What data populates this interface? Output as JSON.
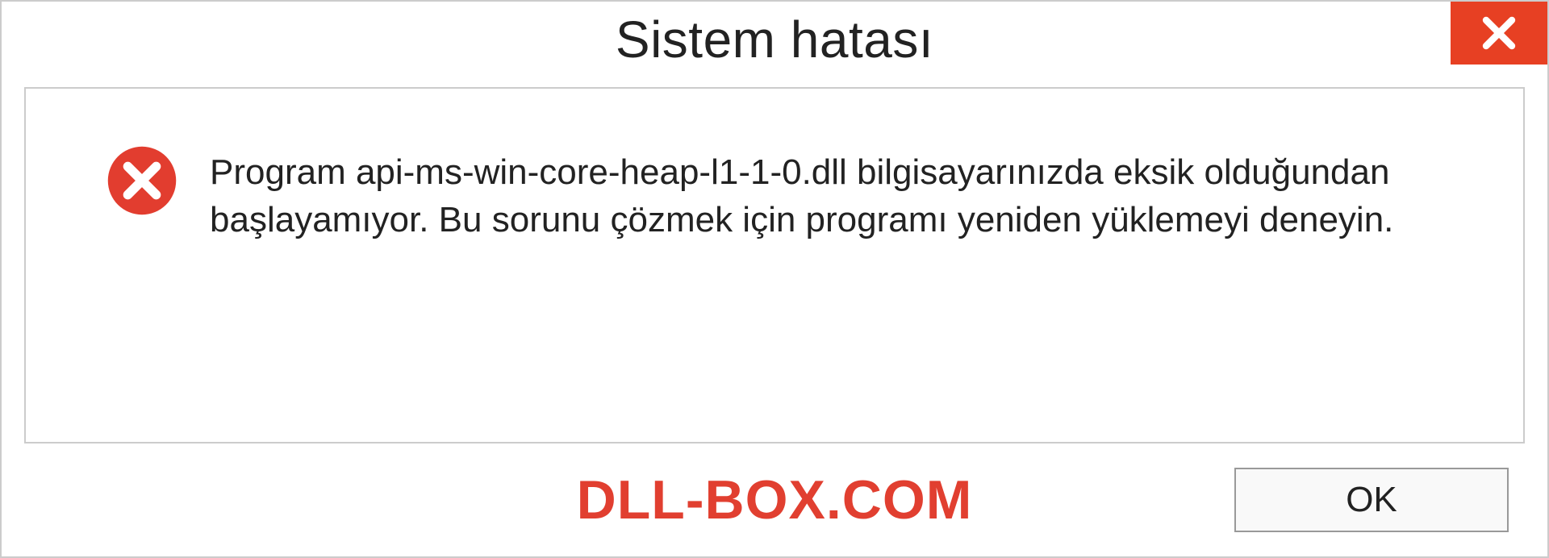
{
  "dialog": {
    "title": "Sistem hatası",
    "message": "Program api-ms-win-core-heap-l1-1-0.dll bilgisayarınızda eksik olduğundan başlayamıyor. Bu sorunu çözmek için programı yeniden yüklemeyi deneyin.",
    "ok_label": "OK"
  },
  "watermark": "DLL-BOX.COM"
}
